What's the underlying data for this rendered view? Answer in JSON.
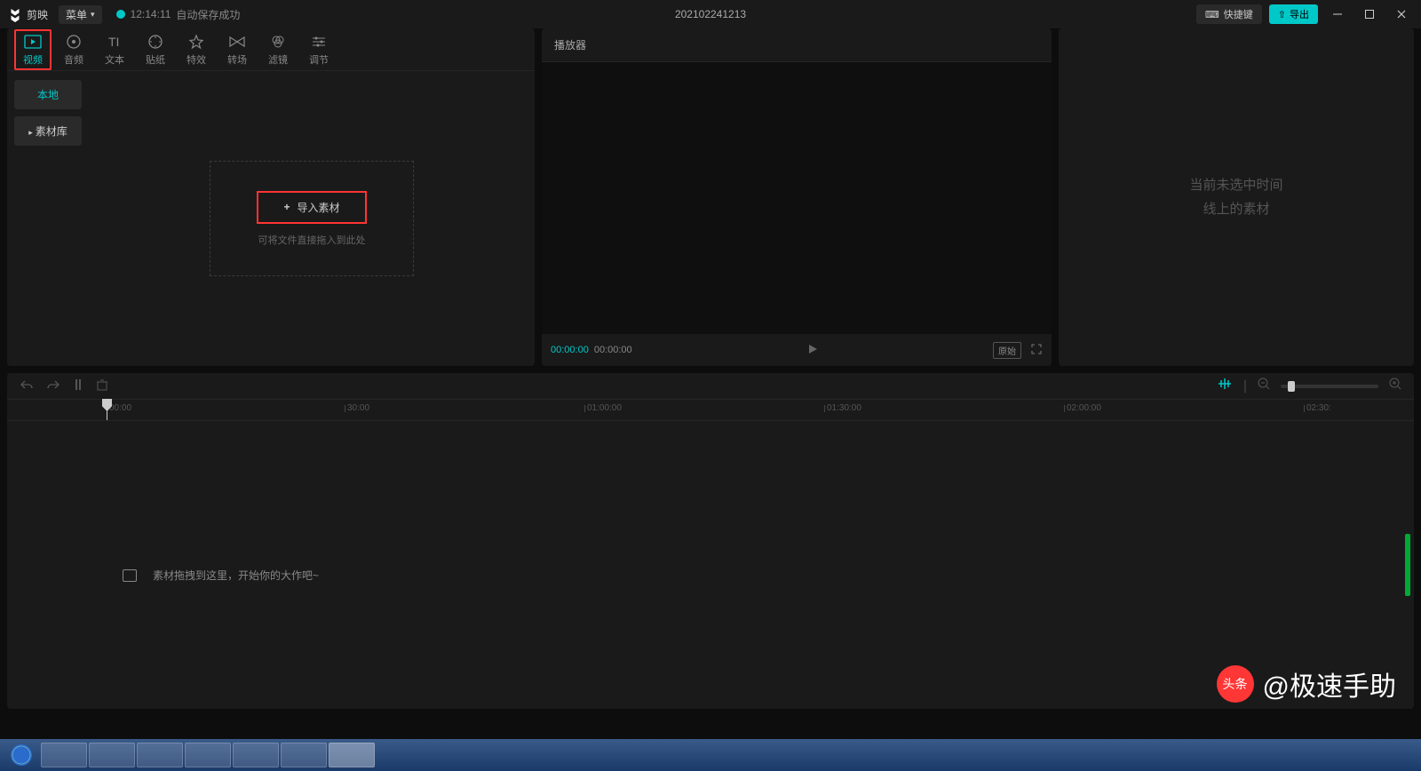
{
  "titlebar": {
    "app_name": "剪映",
    "menu_label": "菜单",
    "autosave_time": "12:14:11",
    "autosave_text": "自动保存成功",
    "project_title": "202102241213",
    "shortcut_label": "快捷键",
    "export_label": "导出"
  },
  "media_tabs": [
    {
      "label": "视频",
      "icon": "video"
    },
    {
      "label": "音频",
      "icon": "audio"
    },
    {
      "label": "文本",
      "icon": "text"
    },
    {
      "label": "贴纸",
      "icon": "sticker"
    },
    {
      "label": "特效",
      "icon": "effect"
    },
    {
      "label": "转场",
      "icon": "transition"
    },
    {
      "label": "滤镜",
      "icon": "filter"
    },
    {
      "label": "调节",
      "icon": "adjust"
    }
  ],
  "media_sidebar": {
    "local_label": "本地",
    "library_label": "素材库"
  },
  "import": {
    "button_label": "导入素材",
    "hint": "可将文件直接拖入到此处"
  },
  "player": {
    "title": "播放器",
    "time_current": "00:00:00",
    "time_total": "00:00:00",
    "ratio_label": "原始"
  },
  "props": {
    "empty_line1": "当前未选中时间",
    "empty_line2": "线上的素材"
  },
  "timeline": {
    "ruler": [
      "00:00",
      "30:00",
      "01:00:00",
      "01:30:00",
      "02:00:00",
      "02:30:"
    ],
    "hint": "素材拖拽到这里，开始你的大作吧~"
  },
  "watermark": {
    "text": "@极速手助"
  }
}
